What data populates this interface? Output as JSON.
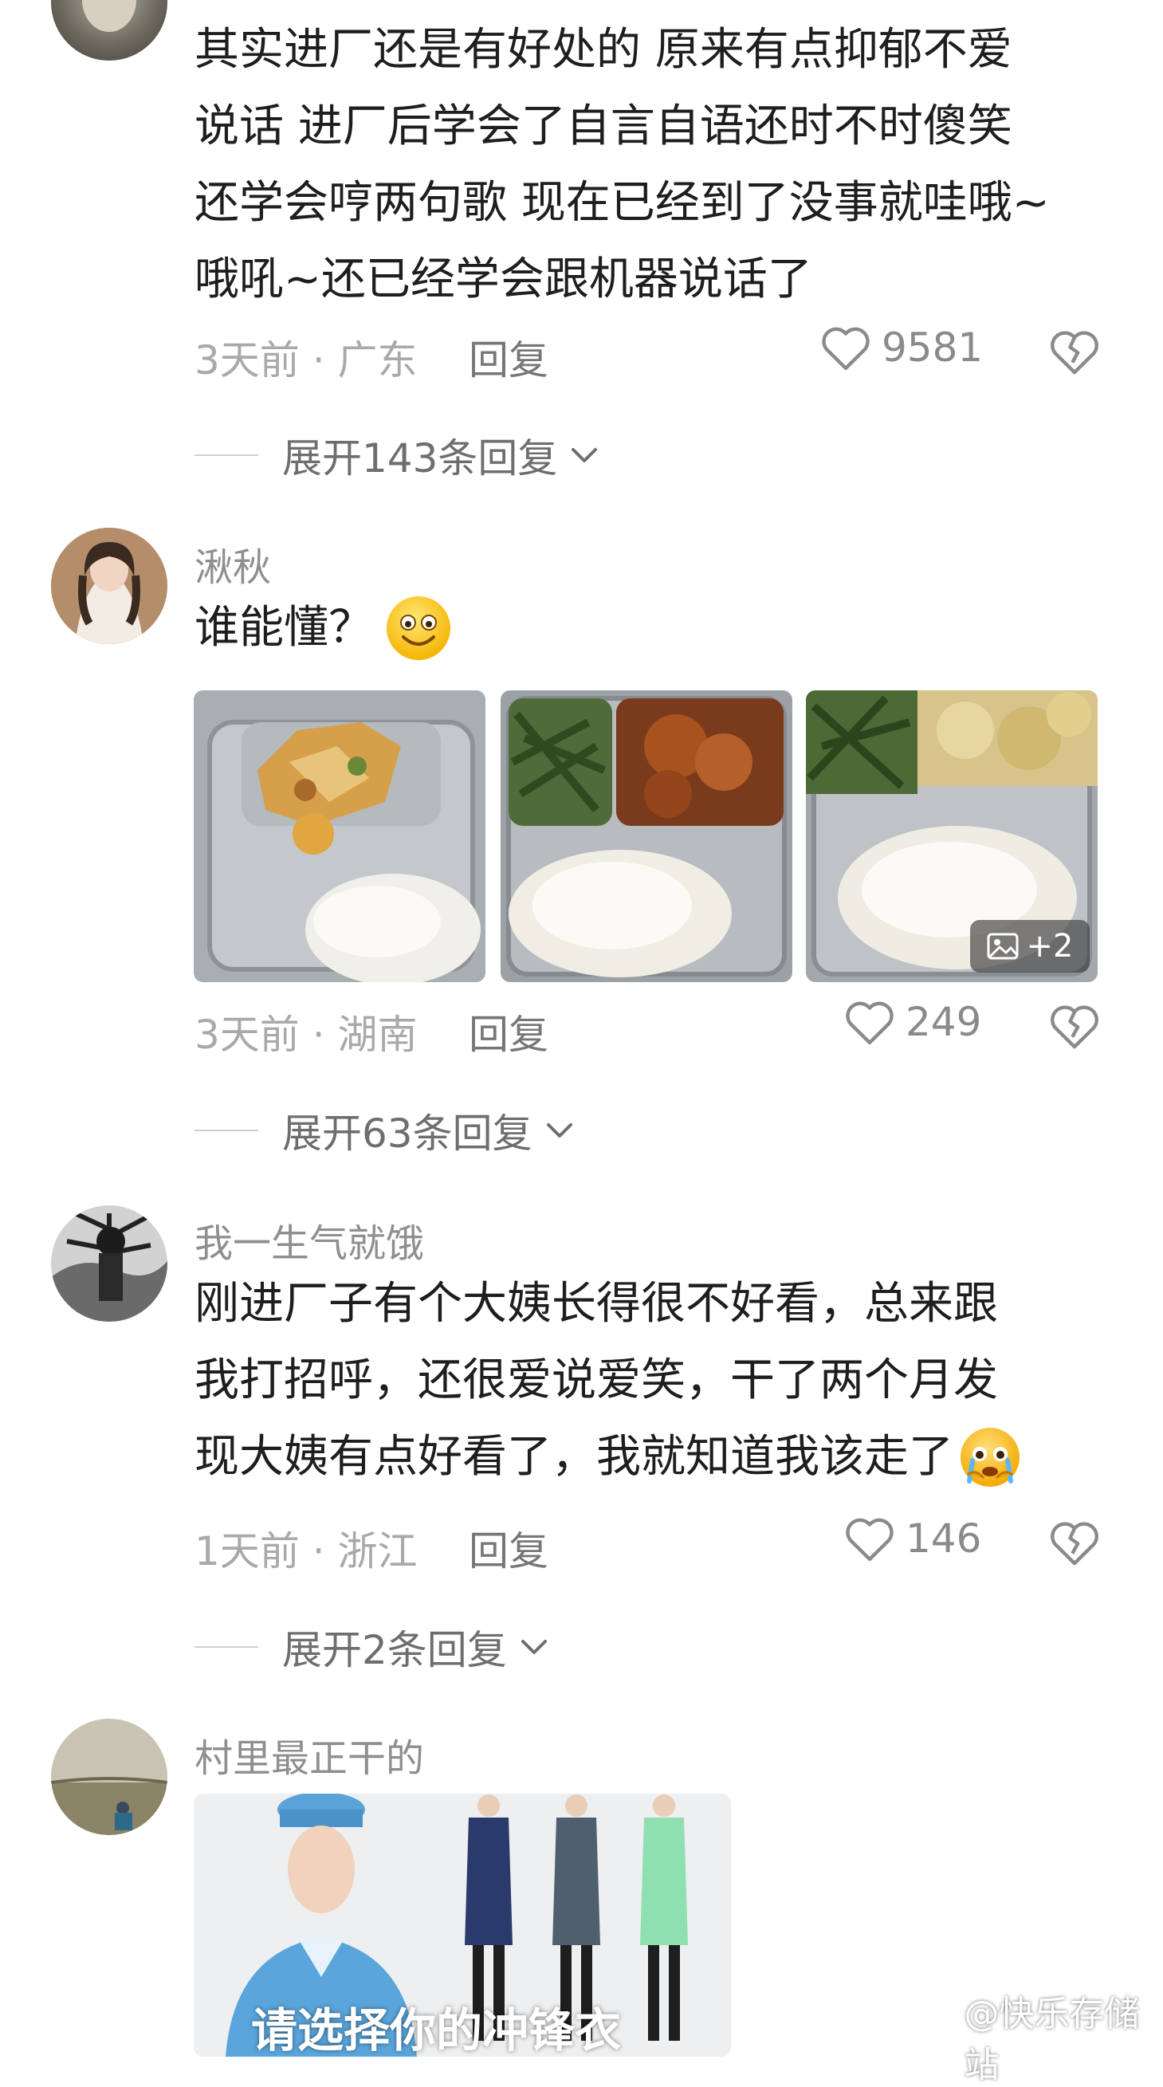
{
  "comments": [
    {
      "username": "",
      "text_lines": [
        "其实进厂还是有好处的 原来有点抑郁不爱",
        "说话 进厂后学会了自言自语还时不时傻笑",
        "还学会哼两句歌 现在已经到了没事就哇哦~",
        "哦吼~还已经学会跟机器说话了"
      ],
      "meta": "3天前 · 广东",
      "reply_label": "回复",
      "likes": "9581",
      "expand_label": "展开143条回复"
    },
    {
      "username": "湫秋",
      "text": "谁能懂？",
      "emoji": "smile-emoji",
      "image_badge": "+2",
      "meta": "3天前 · 湖南",
      "reply_label": "回复",
      "likes": "249",
      "expand_label": "展开63条回复"
    },
    {
      "username": "我一生气就饿",
      "text_lines": [
        "刚进厂子有个大姨长得很不好看，总来跟",
        "我打招呼，还很爱说爱笑，干了两个月发",
        "现大姨有点好看了，我就知道我该走了"
      ],
      "emoji": "crying-emoji",
      "meta": "1天前 · 浙江",
      "reply_label": "回复",
      "likes": "146",
      "expand_label": "展开2条回复"
    },
    {
      "username": "村里最正干的",
      "image_caption": "请选择你的冲锋衣"
    }
  ],
  "watermark": "@快乐存储站",
  "colors": {
    "text": "#1e1e1e",
    "meta": "#a9a9a9",
    "username": "#8f8f8f"
  }
}
